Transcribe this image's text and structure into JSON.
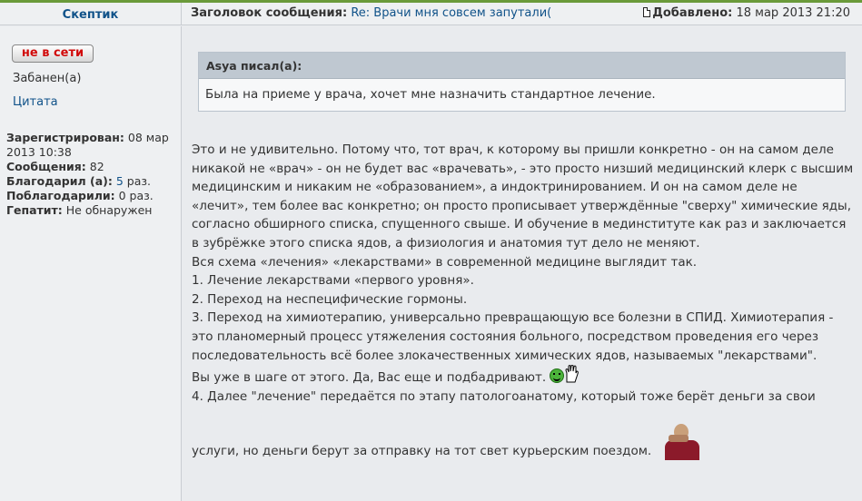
{
  "header": {
    "author": "Скептик",
    "subject_label": "Заголовок сообщения:",
    "subject_value": "Re: Врачи мня совсем запутали(",
    "added_label": "Добавлено:",
    "added_value": "18 мар 2013 21:20"
  },
  "profile": {
    "status_badge": "не в сети",
    "banned": "Забанен(а)",
    "quote_link": "Цитата",
    "registered_label": "Зарегистрирован:",
    "registered_value": "08 мар 2013 10:38",
    "posts_label": "Сообщения:",
    "posts_value": "82",
    "thanked_label": "Благодарил (а):",
    "thanked_value": "5",
    "thanked_suffix": "раз.",
    "thanked_by_label": "Поблагодарили:",
    "thanked_by_value": "0 раз.",
    "hepatitis_label": "Гепатит:",
    "hepatitis_value": "Не обнаружен"
  },
  "quote": {
    "author": "Asya писал(а):",
    "text": "Была на приеме у врача, хочет мне назначить стандартное лечение."
  },
  "post": {
    "p1": "Это и не удивительно. Потому что, тот врач, к которому вы пришли конкретно - он на самом деле никакой не «врач» - он не будет вас «врачевать», - это просто низший медицинский клерк с высшим медицинским и никаким не «образованием», а индоктринированием. И он на самом деле не «лечит», тем более вас конкретно; он просто прописывает утверждённые \"сверху\" химические яды, согласно обширного списка, спущенного свыше. И обучение в мединституте как раз и заключается в зубрёжке этого списка ядов, а физиология и анатомия тут дело не меняют.",
    "p2": "Вся схема «лечения» «лекарствами» в современной медицине выглядит так.",
    "p3": "1. Лечение лекарствами «первого уровня».",
    "p4": "2. Переход на неспецифические гормоны.",
    "p5": "3. Переход на химиотерапию, универсально превращающую все болезни в СПИД. Химиотерапия - это планомерный процесс утяжеления состояния больного, посредством проведения его через последовательность всё более злокачественных химических ядов, называемых \"лекарствами\".",
    "p6": "Вы уже в шаге от этого. Да, Вас еще и подбадривают.",
    "p7": "4. Далее \"лечение\" передаётся по этапу патологоанатому, который тоже берёт деньги за свои",
    "p8": "услуги, но деньги берут за отправку на тот свет курьерским поездом."
  },
  "icons": {
    "post_icon": "document-icon",
    "smile": "applause-smiley-icon",
    "facepalm": "facepalm-icon"
  },
  "colors": {
    "link": "#105289",
    "offline": "#d10a0a",
    "accent_stripe": "#6a9a3a"
  }
}
